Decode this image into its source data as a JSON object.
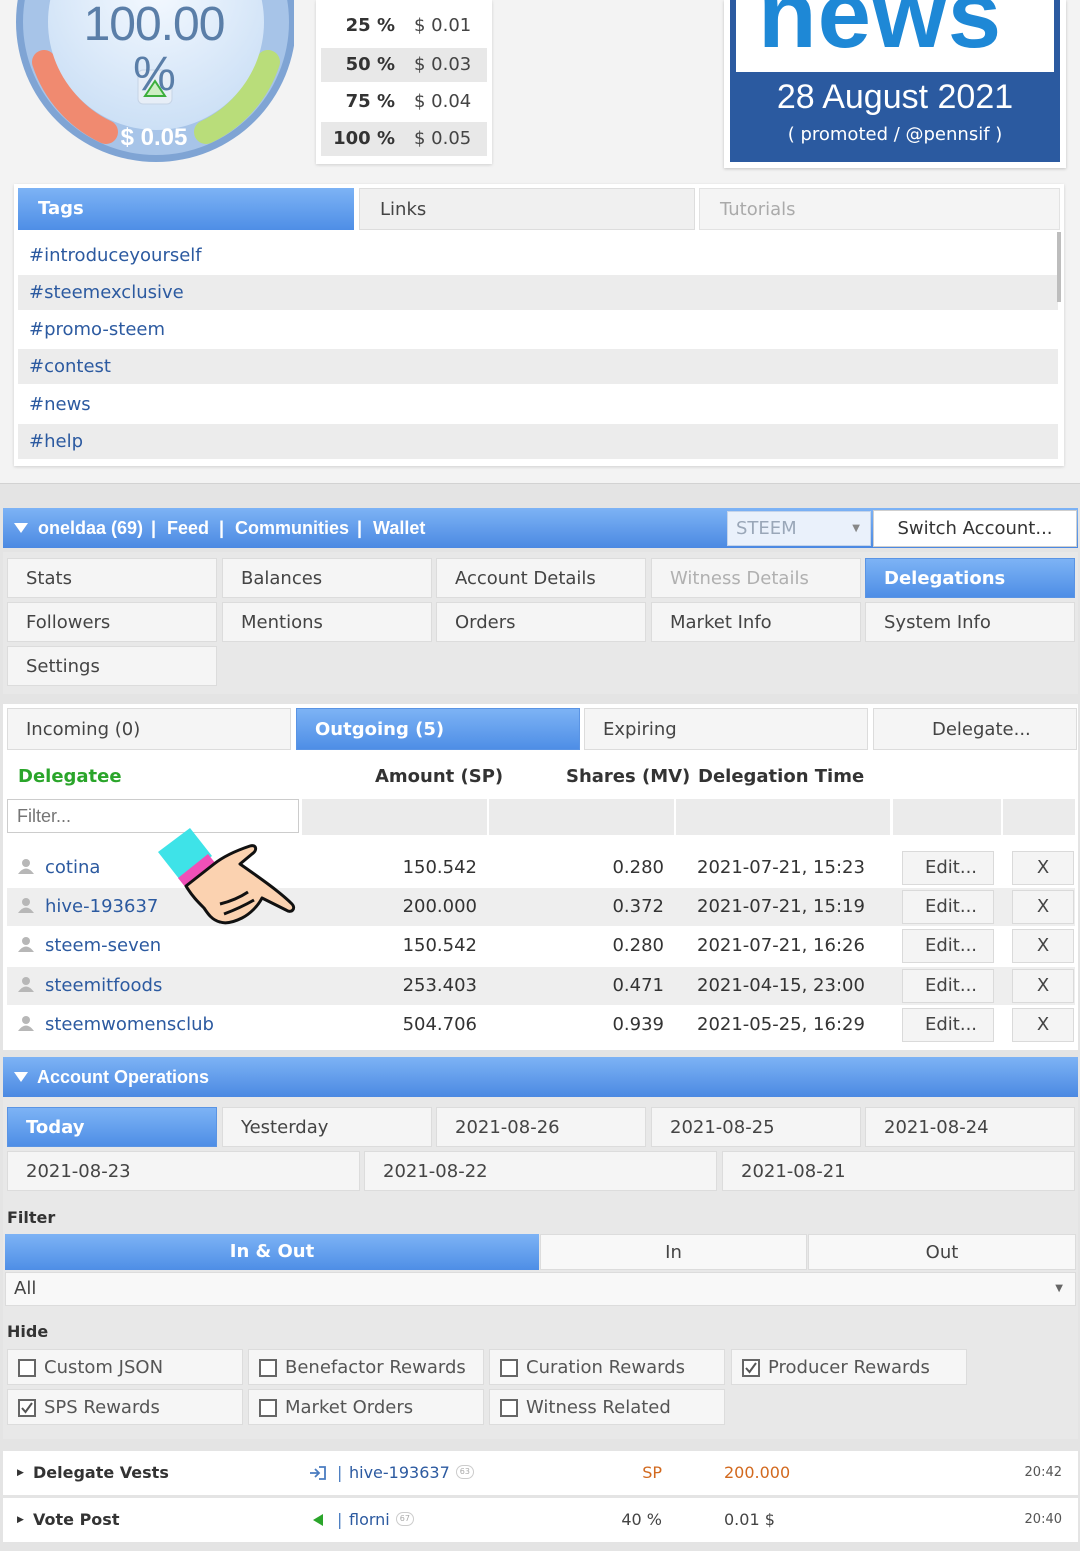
{
  "gauge": {
    "percent": "100.00 %",
    "value": "$ 0.05"
  },
  "vote_values": [
    {
      "pct": "25 %",
      "usd": "$ 0.01"
    },
    {
      "pct": "50 %",
      "usd": "$ 0.03"
    },
    {
      "pct": "75 %",
      "usd": "$ 0.04"
    },
    {
      "pct": "100 %",
      "usd": "$ 0.05"
    }
  ],
  "news": {
    "word": "news",
    "date": "28 August 2021",
    "promo": "( promoted / @pennsif )"
  },
  "tag_tabs": {
    "tags": "Tags",
    "links": "Links",
    "tutorials": "Tutorials"
  },
  "tags": [
    "#introduceyourself",
    "#steemexclusive",
    "#promo-steem",
    "#contest",
    "#news",
    "#help"
  ],
  "account_bar": {
    "user": "oneldaa (69)",
    "sep": "|",
    "feed": "Feed",
    "communities": "Communities",
    "wallet": "Wallet",
    "currency": "STEEM",
    "switch": "Switch Account..."
  },
  "nav": {
    "stats": "Stats",
    "balances": "Balances",
    "account_details": "Account Details",
    "witness_details": "Witness Details",
    "delegations": "Delegations",
    "followers": "Followers",
    "mentions": "Mentions",
    "orders": "Orders",
    "market_info": "Market Info",
    "system_info": "System Info",
    "settings": "Settings"
  },
  "deleg_tabs": {
    "incoming": "Incoming (0)",
    "outgoing": "Outgoing (5)",
    "expiring": "Expiring",
    "delegate": "Delegate..."
  },
  "deleg_headers": {
    "delegatee": "Delegatee",
    "amount": "Amount (SP)",
    "shares": "Shares (MV)",
    "time": "Delegation Time"
  },
  "filter_placeholder": "Filter...",
  "delegations": [
    {
      "user": "cotina",
      "amount": "150.542",
      "shares": "0.280",
      "time": "2021-07-21, 15:23",
      "edit": "Edit...",
      "x": "X"
    },
    {
      "user": "hive-193637",
      "amount": "200.000",
      "shares": "0.372",
      "time": "2021-07-21, 15:19",
      "edit": "Edit...",
      "x": "X"
    },
    {
      "user": "steem-seven",
      "amount": "150.542",
      "shares": "0.280",
      "time": "2021-07-21, 16:26",
      "edit": "Edit...",
      "x": "X"
    },
    {
      "user": "steemitfoods",
      "amount": "253.403",
      "shares": "0.471",
      "time": "2021-04-15, 23:00",
      "edit": "Edit...",
      "x": "X"
    },
    {
      "user": "steemwomensclub",
      "amount": "504.706",
      "shares": "0.939",
      "time": "2021-05-25, 16:29",
      "edit": "Edit...",
      "x": "X"
    }
  ],
  "ops": {
    "title": "Account Operations",
    "days": [
      "Today",
      "Yesterday",
      "2021-08-26",
      "2021-08-25",
      "2021-08-24",
      "2021-08-23",
      "2021-08-22",
      "2021-08-21"
    ],
    "filter_label": "Filter",
    "dir": {
      "inout": "In & Out",
      "in": "In",
      "out": "Out"
    },
    "select_value": "All",
    "hide_label": "Hide",
    "hide_options": [
      {
        "label": "Custom JSON",
        "checked": false
      },
      {
        "label": "Benefactor Rewards",
        "checked": false
      },
      {
        "label": "Curation Rewards",
        "checked": false
      },
      {
        "label": "Producer Rewards",
        "checked": true
      },
      {
        "label": "SPS Rewards",
        "checked": true
      },
      {
        "label": "Market Orders",
        "checked": false
      },
      {
        "label": "Witness Related",
        "checked": false
      }
    ],
    "rows": [
      {
        "name": "Delegate Vests",
        "sep": "|",
        "who": "hive-193637",
        "rep": "63",
        "c1": "SP",
        "c2": "200.000",
        "time": "20:42"
      },
      {
        "name": "Vote Post",
        "sep": "|",
        "who": "florni",
        "rep": "67",
        "c1": "40 %",
        "c2": "0.01 $",
        "time": "20:40"
      }
    ]
  },
  "colors": {
    "accent": "#4e8ee6",
    "link": "#2c5aa0",
    "green_header": "#2aa52a",
    "orange_value": "#d2691e"
  }
}
